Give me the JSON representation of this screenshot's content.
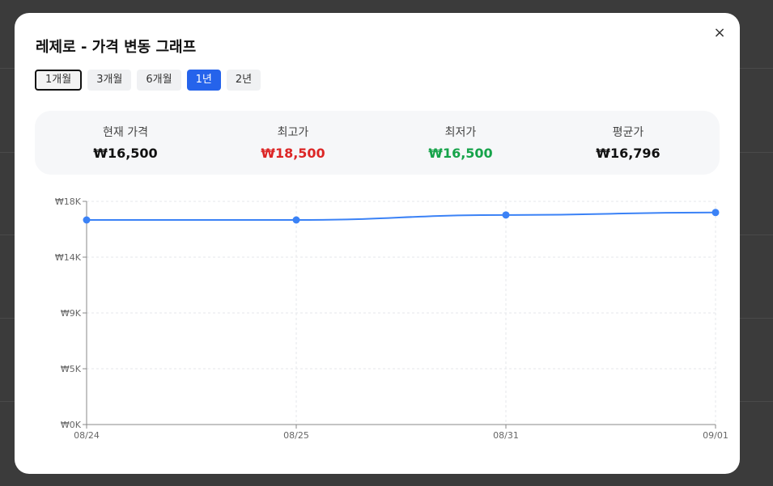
{
  "modal": {
    "title": "레제로 - 가격 변동 그래프",
    "close_label": "×"
  },
  "tabs": [
    {
      "label": "1개월",
      "state": "outlined"
    },
    {
      "label": "3개월",
      "state": "normal"
    },
    {
      "label": "6개월",
      "state": "normal"
    },
    {
      "label": "1년",
      "state": "active"
    },
    {
      "label": "2년",
      "state": "normal"
    }
  ],
  "stats": [
    {
      "label": "현재 가격",
      "value": "₩16,500",
      "color": "#111111"
    },
    {
      "label": "최고가",
      "value": "₩18,500",
      "color": "#dc2626"
    },
    {
      "label": "최저가",
      "value": "₩16,500",
      "color": "#16a34a"
    },
    {
      "label": "평균가",
      "value": "₩16,796",
      "color": "#111111"
    }
  ],
  "chart_data": {
    "type": "line",
    "categories": [
      "08/24",
      "08/25",
      "08/31",
      "09/01"
    ],
    "series": [
      {
        "values": [
          16500,
          16500,
          16900,
          17100
        ],
        "color": "#3b82f6"
      }
    ],
    "y_ticks": [
      "₩0K",
      "₩5K",
      "₩9K",
      "₩14K",
      "₩18K"
    ],
    "y_tick_values": [
      0,
      4500,
      9000,
      13500,
      18000
    ],
    "ylim": [
      0,
      18000
    ],
    "grid": true
  }
}
